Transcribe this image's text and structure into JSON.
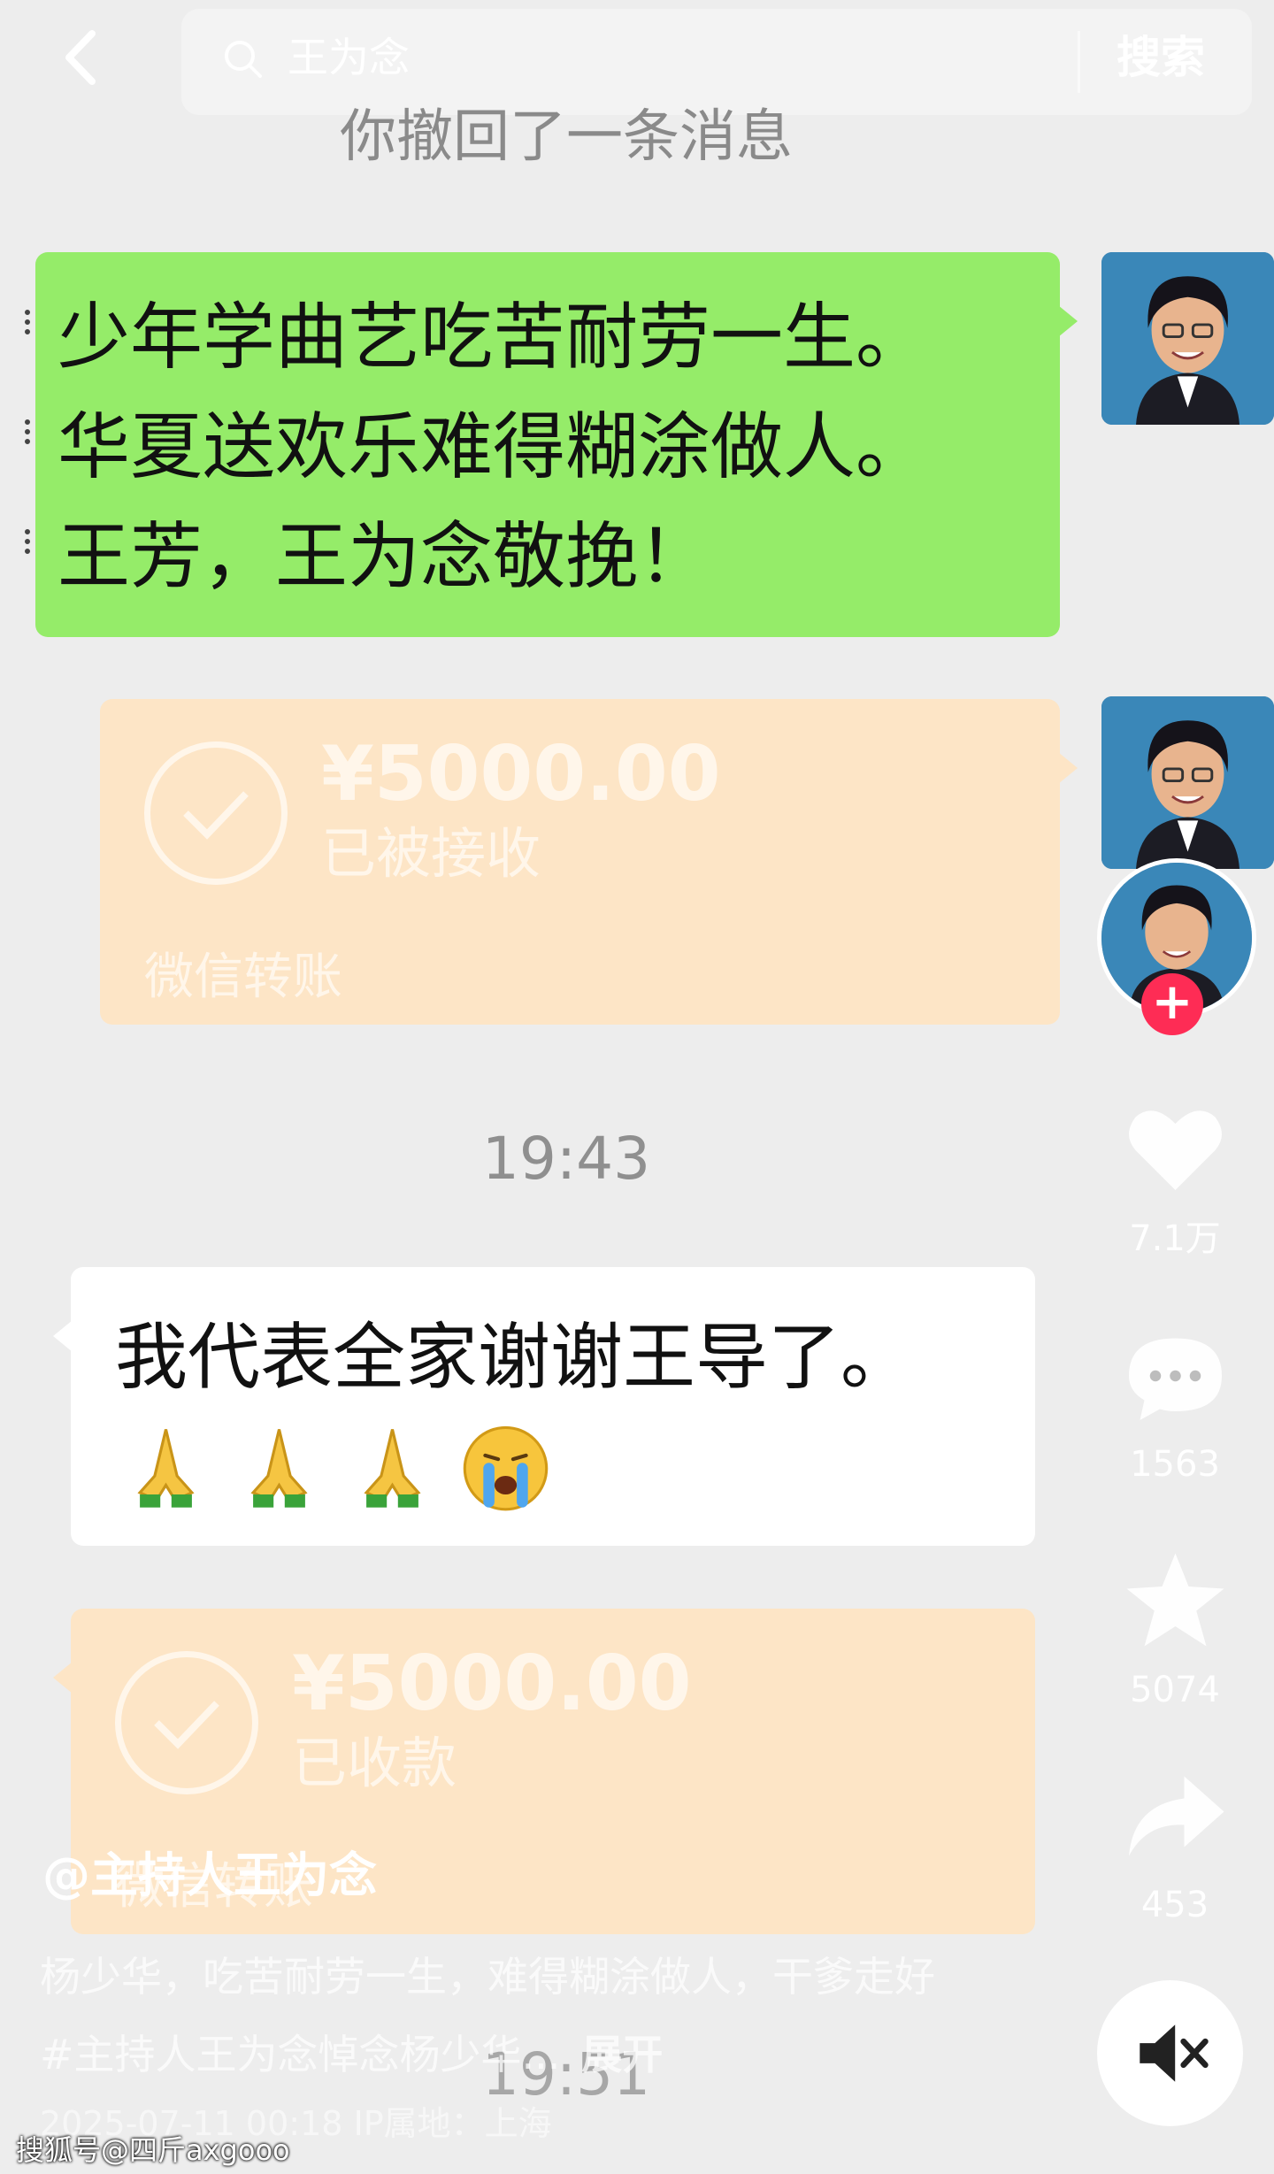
{
  "search": {
    "query": "王为念",
    "button_label": "搜索"
  },
  "chat": {
    "recall_notice": "你撤回了一条消息",
    "green_message_lines": [
      "少年学曲艺吃苦耐劳一生。",
      "华夏送欢乐难得糊涂做人。",
      "王芳，王为念敬挽！"
    ],
    "transfer_1": {
      "amount": "¥5000.00",
      "status": "已被接收",
      "label": "微信转账"
    },
    "time_1": "19:43",
    "white_message": "我代表全家谢谢王导了。",
    "emojis": [
      "folded-hands",
      "folded-hands",
      "folded-hands",
      "loudly-crying-face"
    ],
    "transfer_2": {
      "amount": "¥5000.00",
      "status": "已收款",
      "label": "微信转账"
    },
    "time_2": "19:51"
  },
  "side_actions": {
    "likes": "7.1万",
    "comments": "1563",
    "favorites": "5074",
    "shares": "453"
  },
  "post": {
    "author": "@主持人王为念",
    "caption": "杨少华，吃苦耐劳一生，难得糊涂做人，干爹走好 #主持人王为念悼念杨少华...",
    "expand_label": "展开",
    "meta": "2025-07-11 00:18  IP属地：上海"
  },
  "watermark": "搜狐号@四斤axgooo",
  "colors": {
    "green_bubble": "#95ec69",
    "transfer_card": "#fde5c6",
    "follow_plus": "#fe2c55",
    "background": "#ededed"
  }
}
